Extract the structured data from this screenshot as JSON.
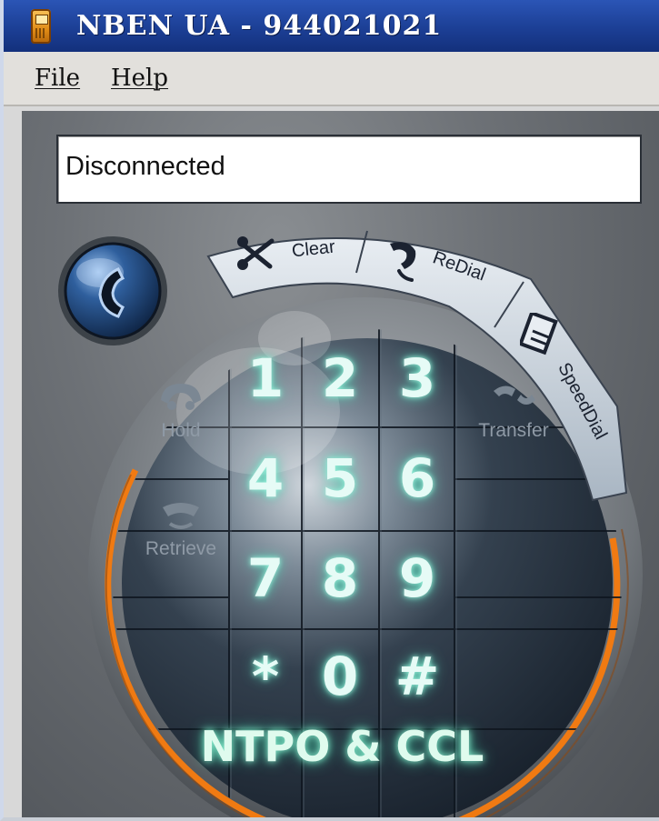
{
  "window": {
    "title": "NBEN UA - 944021021"
  },
  "menu": {
    "file": "File",
    "help": "Help"
  },
  "status": {
    "text": "Disconnected"
  },
  "actions": {
    "clear": "Clear",
    "redial": "ReDial",
    "speeddial": "SpeedDial",
    "hold": "Hold",
    "retrieve": "Retrieve",
    "transfer": "Transfer"
  },
  "keypad": {
    "keys": [
      "1",
      "2",
      "3",
      "4",
      "5",
      "6",
      "7",
      "8",
      "9",
      "*",
      "0",
      "#"
    ]
  },
  "brand": "NTPO & CCL",
  "colors": {
    "titlebar": "#1c3f95",
    "ring_accent": "#f07a12",
    "key_glow": "#9ff5df",
    "dial_face": "#1f2a38"
  },
  "icons": {
    "app": "phone-app-icon",
    "call_button": "handset-icon",
    "clear": "scissors-icon",
    "redial": "redial-handset-icon",
    "speeddial": "phonebook-icon",
    "hold": "hold-handset-icon",
    "retrieve": "retrieve-handset-icon",
    "transfer": "transfer-handset-icon"
  }
}
